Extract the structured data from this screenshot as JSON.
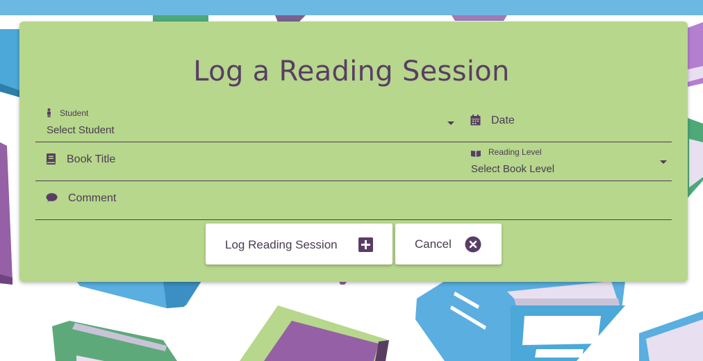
{
  "form": {
    "title": "Log a Reading Session",
    "student": {
      "label": "Student",
      "value": "Select Student"
    },
    "date": {
      "placeholder": "Date"
    },
    "book_title": {
      "placeholder": "Book Title"
    },
    "reading_level": {
      "label": "Reading Level",
      "value": "Select Book Level"
    },
    "comment": {
      "placeholder": "Comment"
    }
  },
  "buttons": {
    "submit_label": "Log Reading Session",
    "cancel_label": "Cancel"
  },
  "colors": {
    "card": "#b6d78c",
    "accent": "#5a3d64",
    "topbar": "#6bb8e2"
  },
  "icons": {
    "student": "person-icon",
    "date": "calendar-icon",
    "book_title": "book-icon",
    "reading_level": "open-book-icon",
    "comment": "speech-bubble-icon",
    "submit": "plus-square-icon",
    "cancel": "close-circle-icon"
  }
}
